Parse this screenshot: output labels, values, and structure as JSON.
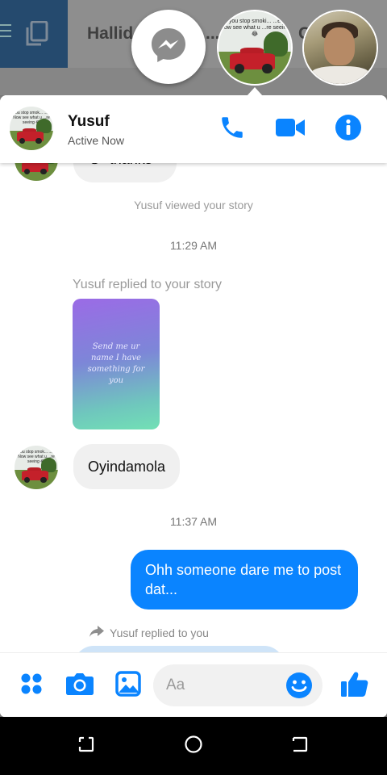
{
  "background_app": {
    "title": "Hallid",
    "title_tail": "...",
    "partial_letter": "C"
  },
  "chat_heads": {
    "items": [
      {
        "type": "messenger-icon"
      },
      {
        "type": "contact",
        "caption": "...you stop smoki... ...ed. Now see what u ...re seeing 😂"
      },
      {
        "type": "contact-photo"
      }
    ]
  },
  "header": {
    "contact_name": "Yusuf",
    "status": "Active Now",
    "accent_color": "#0a84ff"
  },
  "thread": {
    "top_partial_message": "thanks",
    "avatar_caption": "...you stop smok... ...ed. Now see what u ...re seeing 😂",
    "system_viewed": "Yusuf viewed your story",
    "time_1": "11:29 AM",
    "story_reply_label": "Yusuf replied to your story",
    "story_text": "Send me ur name I have something for you",
    "incoming_message": "Oyindamola",
    "time_2": "11:37 AM",
    "outgoing_message": "Ohh someone dare me to post dat...",
    "reply_note": "Yusuf replied to you"
  },
  "composer": {
    "placeholder": "Aa"
  },
  "icons": {
    "call": "phone-icon",
    "video": "video-camera-icon",
    "info": "info-icon",
    "apps": "four-dots-icon",
    "camera": "camera-icon",
    "gallery": "image-icon",
    "emoji": "smiley-icon",
    "like": "thumbs-up-icon"
  }
}
